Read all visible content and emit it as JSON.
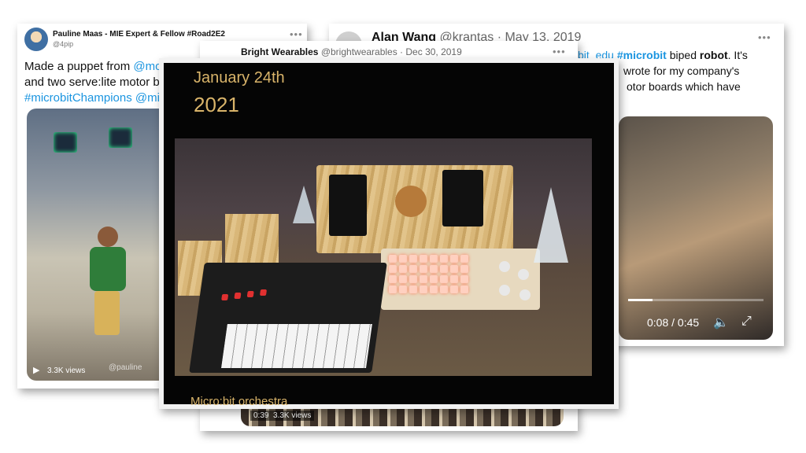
{
  "tweet_pauline": {
    "name": "Pauline Maas - MIE Expert & Fellow #Road2E2",
    "handle": "@4pip",
    "text_line1_prefix": "Made a puppet from ",
    "text_line1_mention": "@mo",
    "text_line2": "and two  serve:lite motor bo",
    "text_line3_tag": "#microbitChampions",
    "text_line3_mention": "@mic",
    "views": "3.3K views",
    "watermark": "@pauline"
  },
  "tweet_alan": {
    "name": "Alan Wang",
    "handle_date": "@krantas · May 13, 2019",
    "line1_pre": "bit_edu",
    "line1_tag": "#microbit",
    "line1_mid": " biped ",
    "line1_bold": "robot",
    "line1_end": ". It's",
    "line2": "wrote for my company's",
    "line3": "otor boards which have",
    "video_time": "0:08 / 0:45",
    "progress": 0.18
  },
  "tweet_bright": {
    "name": "Bright Wearables",
    "handle_date": "@brightwearables · Dec 30, 2019",
    "video_duration": "0:39",
    "views": "3.3K views"
  },
  "main_video": {
    "date_line1": "January 24th",
    "date_line2": "2021",
    "caption": "Micro:bit orchestra"
  },
  "icons": {
    "more": "more-icon",
    "play": "play-icon",
    "volume": "volume-icon",
    "fullscreen": "fullscreen-icon"
  },
  "colors": {
    "link": "#1b95e0",
    "caption_gold": "#d9b46a"
  }
}
